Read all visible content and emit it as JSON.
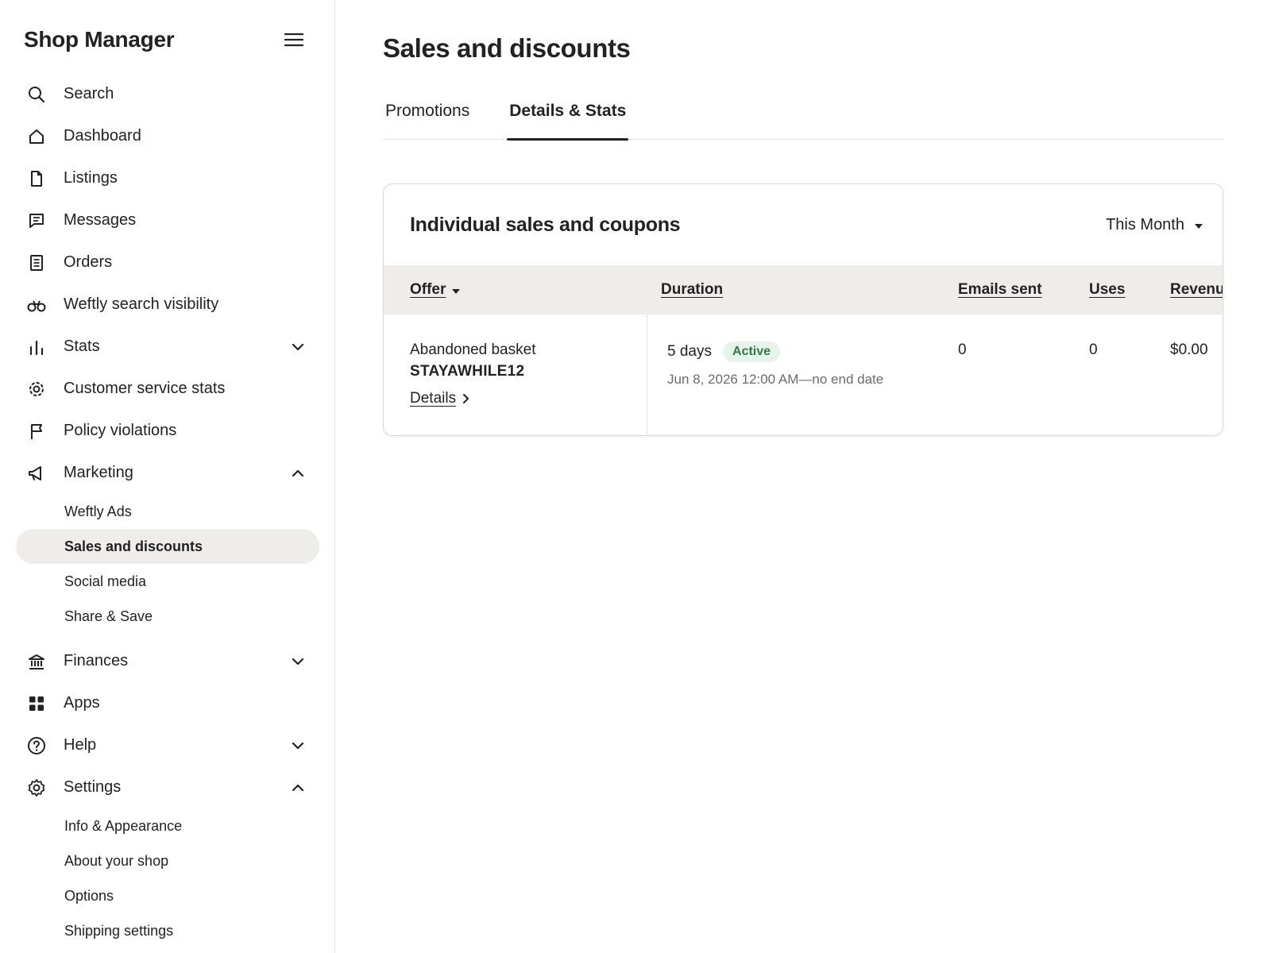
{
  "sidebar": {
    "title": "Shop Manager",
    "menu_icon": "hamburger-menu-icon",
    "items": [
      {
        "label": "Search",
        "icon": "search-icon"
      },
      {
        "label": "Dashboard",
        "icon": "home-icon"
      },
      {
        "label": "Listings",
        "icon": "document-icon"
      },
      {
        "label": "Messages",
        "icon": "message-icon"
      },
      {
        "label": "Orders",
        "icon": "receipt-icon"
      },
      {
        "label": "Weftly search visibility",
        "icon": "binoculars-icon"
      },
      {
        "label": "Stats",
        "icon": "bar-chart-icon",
        "expanded": false
      },
      {
        "label": "Customer service stats",
        "icon": "gear-badge-icon"
      },
      {
        "label": "Policy violations",
        "icon": "flag-icon"
      },
      {
        "label": "Marketing",
        "icon": "megaphone-icon",
        "expanded": true
      },
      {
        "label": "Finances",
        "icon": "bank-icon",
        "expanded": false
      },
      {
        "label": "Apps",
        "icon": "grid-icon"
      },
      {
        "label": "Help",
        "icon": "help-circle-icon",
        "expanded": false
      },
      {
        "label": "Settings",
        "icon": "settings-icon",
        "expanded": true
      }
    ],
    "marketing_sub": [
      "Weftly Ads",
      "Sales and discounts",
      "Social media",
      "Share & Save"
    ],
    "settings_sub": [
      "Info & Appearance",
      "About your shop",
      "Options",
      "Shipping settings"
    ],
    "active_item": "Sales and discounts"
  },
  "main": {
    "title": "Sales and discounts",
    "tabs": [
      {
        "label": "Promotions",
        "active": false
      },
      {
        "label": "Details & Stats",
        "active": true
      }
    ],
    "card": {
      "title": "Individual sales and coupons",
      "period": "This Month",
      "columns": [
        "Offer",
        "Duration",
        "Emails sent",
        "Uses",
        "Revenu"
      ],
      "rows": [
        {
          "offer_name": "Abandoned basket",
          "offer_code": "STAYAWHILE12",
          "details_link": "Details",
          "duration": "5 days",
          "status": "Active",
          "date_range": "Jun 8, 2026 12:00 AM—no end date",
          "emails_sent": "0",
          "uses": "0",
          "revenue": "$0.00"
        }
      ]
    }
  },
  "colors": {
    "text": "#222222",
    "active_bg": "#eeede9",
    "badge_bg": "#e6f2ea",
    "badge_text": "#2f7a4a",
    "muted_text": "#6b6b6b"
  }
}
